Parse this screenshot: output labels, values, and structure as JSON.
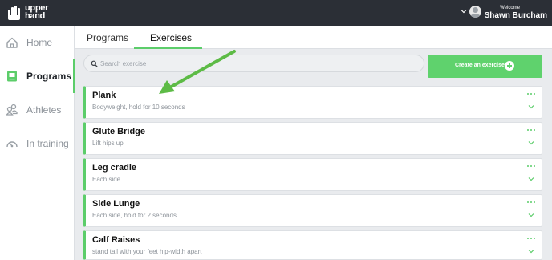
{
  "brand": {
    "name_line1": "upper",
    "name_line2": "hand"
  },
  "user": {
    "welcome": "Welcome",
    "name": "Shawn Burcham"
  },
  "sidebar": {
    "items": [
      {
        "label": "Home",
        "icon": "home-icon",
        "active": false
      },
      {
        "label": "Programs",
        "icon": "book-icon",
        "active": true
      },
      {
        "label": "Athletes",
        "icon": "athletes-icon",
        "active": false
      },
      {
        "label": "In training",
        "icon": "gauge-icon",
        "active": false
      }
    ]
  },
  "tabs": [
    {
      "label": "Programs",
      "active": false
    },
    {
      "label": "Exercises",
      "active": true
    }
  ],
  "search": {
    "placeholder": "Search exercise",
    "value": ""
  },
  "create_button": {
    "label": "Create an exercise"
  },
  "exercises": [
    {
      "title": "Plank",
      "description": "Bodyweight, hold for 10 seconds"
    },
    {
      "title": "Glute Bridge",
      "description": "Lift hips up"
    },
    {
      "title": "Leg cradle",
      "description": "Each side"
    },
    {
      "title": "Side Lunge",
      "description": "Each side, hold for 2 seconds"
    },
    {
      "title": "Calf Raises",
      "description": "stand tall with your feet hip-width apart"
    }
  ],
  "colors": {
    "accent": "#5ccd6a",
    "topbar": "#2b2f36",
    "annotation_arrow": "#5dbb46"
  }
}
